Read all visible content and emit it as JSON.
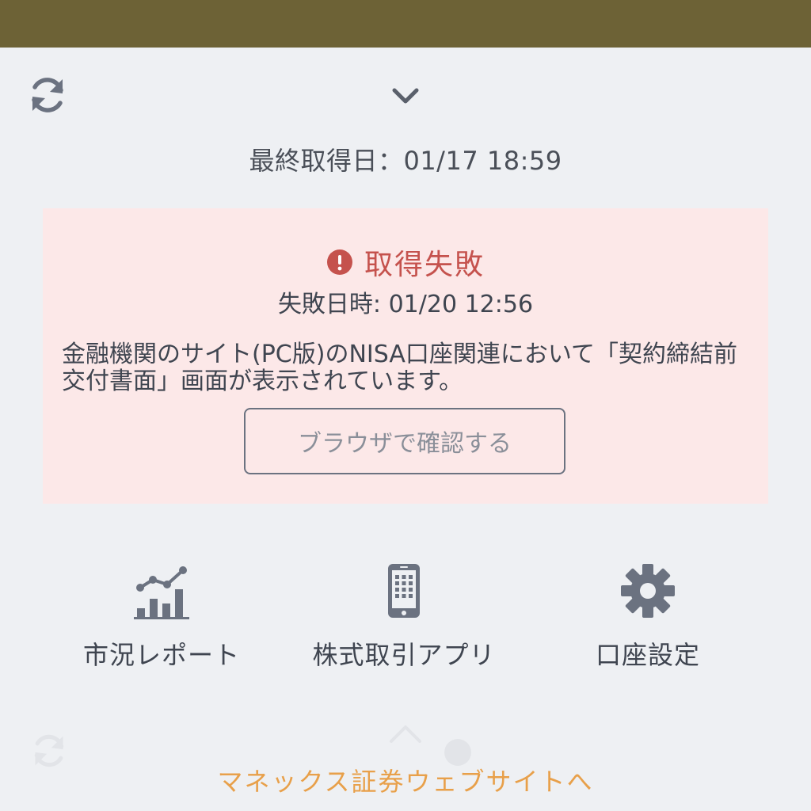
{
  "last_fetch": {
    "label": "最終取得日：",
    "value": "01/17 18:59"
  },
  "alert": {
    "title": "取得失敗",
    "date_label": "失敗日時: ",
    "date_value": "01/20 12:56",
    "message": "金融機関のサイト(PC版)のNISA口座関連において「契約締結前交付書面」画面が表示されています。",
    "button_label": "ブラウザで確認する"
  },
  "nav": [
    {
      "label": "市況レポート",
      "icon": "chart-icon"
    },
    {
      "label": "株式取引アプリ",
      "icon": "smartphone-icon"
    },
    {
      "label": "口座設定",
      "icon": "gear-icon"
    }
  ],
  "footer": {
    "link_label": "マネックス証券ウェブサイトへ"
  },
  "colors": {
    "header": "#6d6236",
    "alert_bg": "#fce8e8",
    "alert_red": "#c5524d",
    "icon_gray": "#6b7280",
    "link_orange": "#e8a04a"
  }
}
